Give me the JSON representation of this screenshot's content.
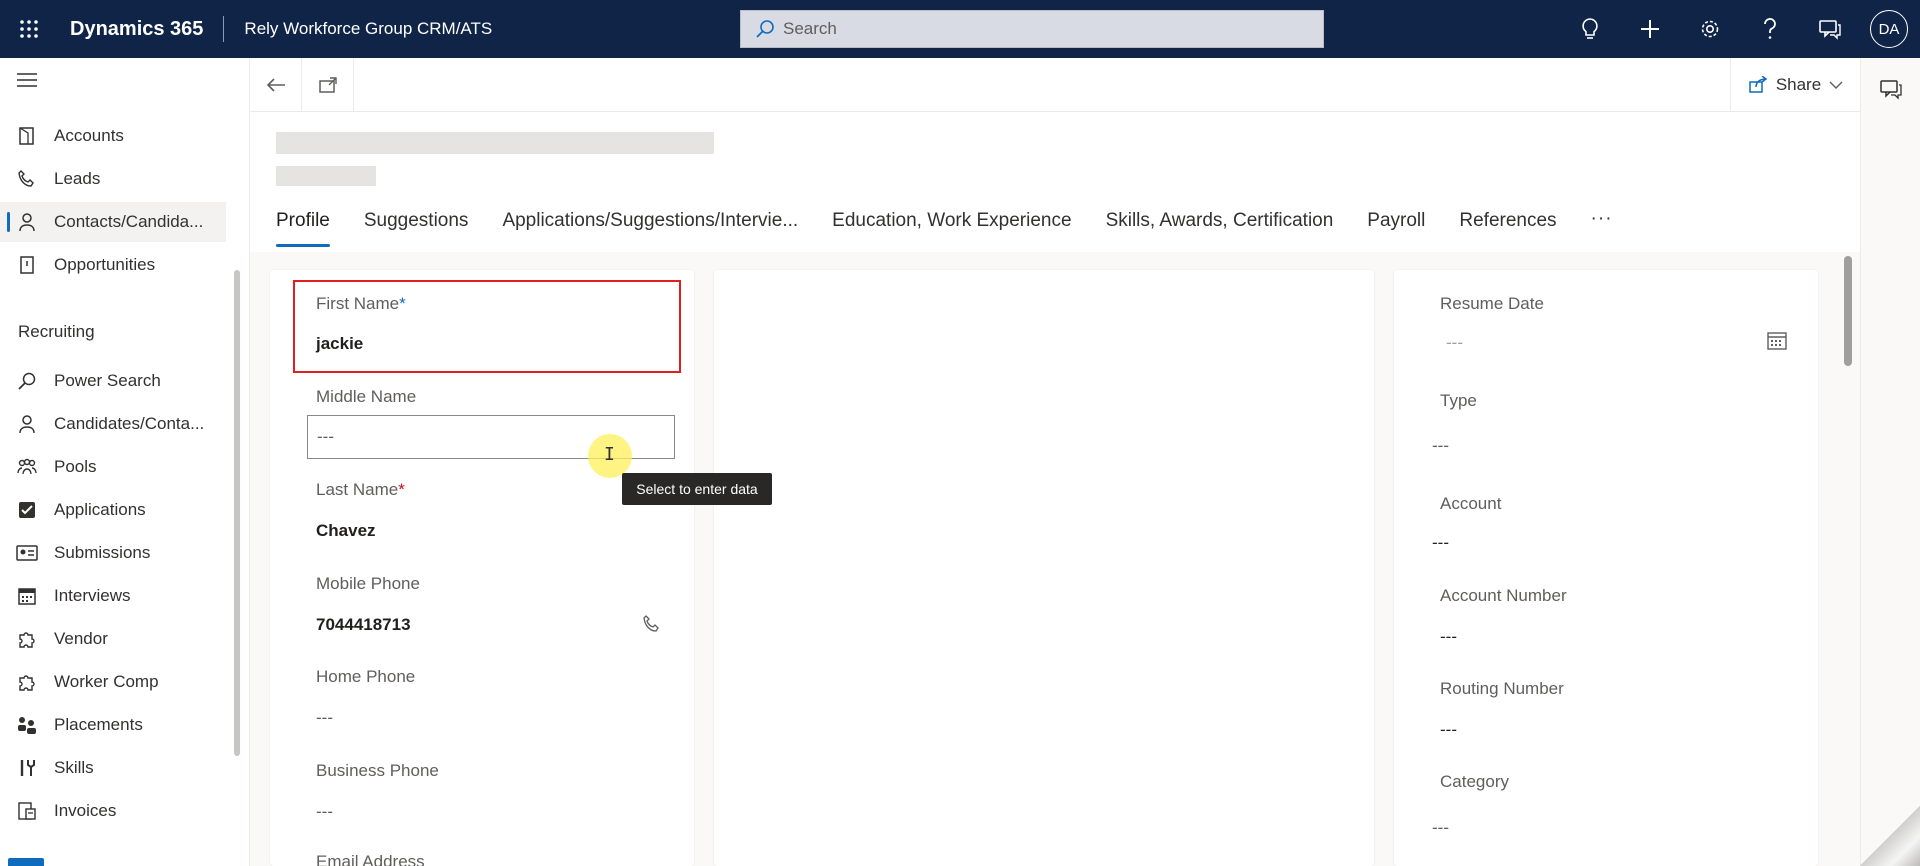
{
  "topbar": {
    "app_name": "Dynamics 365",
    "environment": "Rely Workforce Group CRM/ATS",
    "search_placeholder": "Search",
    "avatar_initials": "DA"
  },
  "sidebar": {
    "items_top": [
      {
        "label": "Accounts",
        "icon": "accounts-icon"
      },
      {
        "label": "Leads",
        "icon": "phone-icon"
      },
      {
        "label": "Contacts/Candida...",
        "icon": "person-icon"
      },
      {
        "label": "Opportunities",
        "icon": "document-icon"
      }
    ],
    "section": "Recruiting",
    "items_recruiting": [
      {
        "label": "Power Search",
        "icon": "search-icon"
      },
      {
        "label": "Candidates/Conta...",
        "icon": "person-icon"
      },
      {
        "label": "Pools",
        "icon": "group-icon"
      },
      {
        "label": "Applications",
        "icon": "checkbox-icon"
      },
      {
        "label": "Submissions",
        "icon": "id-card-icon"
      },
      {
        "label": "Interviews",
        "icon": "calendar-icon"
      },
      {
        "label": "Vendor",
        "icon": "puzzle-icon"
      },
      {
        "label": "Worker Comp",
        "icon": "puzzle-icon"
      },
      {
        "label": "Placements",
        "icon": "people-icon"
      },
      {
        "label": "Skills",
        "icon": "tools-icon"
      },
      {
        "label": "Invoices",
        "icon": "invoice-icon"
      }
    ]
  },
  "command_bar": {
    "share_label": "Share"
  },
  "tabs": [
    "Profile",
    "Suggestions",
    "Applications/Suggestions/Intervie...",
    "Education, Work Experience",
    "Skills, Awards, Certification",
    "Payroll",
    "References"
  ],
  "tabs_more": "···",
  "form_left": {
    "first_name_label": "First Name",
    "first_name_value": "jackie",
    "middle_name_label": "Middle Name",
    "middle_name_placeholder": "---",
    "last_name_label": "Last Name",
    "last_name_value": "Chavez",
    "mobile_phone_label": "Mobile Phone",
    "mobile_phone_value": "7044418713",
    "home_phone_label": "Home Phone",
    "home_phone_value": "---",
    "business_phone_label": "Business Phone",
    "business_phone_value": "---",
    "email_label": "Email Address",
    "required_marker": "*"
  },
  "tooltip": "Select to enter data",
  "form_right": {
    "resume_date_label": "Resume Date",
    "resume_date_value": "---",
    "type_label": "Type",
    "type_value": "---",
    "account_label": "Account",
    "account_value": "---",
    "account_number_label": "Account Number",
    "account_number_value": "---",
    "routing_number_label": "Routing Number",
    "routing_number_value": "---",
    "category_label": "Category",
    "category_value": "---"
  }
}
